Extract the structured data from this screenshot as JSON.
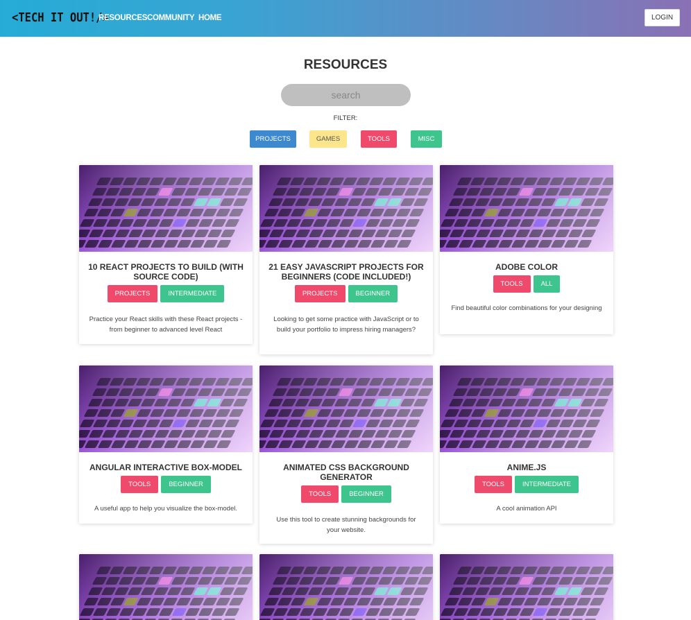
{
  "nav": {
    "logo": "<TECH IT OUT!/>",
    "links": [
      "RESOURCES",
      "COMMUNITY",
      "HOME"
    ],
    "login": "LOGIN"
  },
  "page": {
    "title": "RESOURCES",
    "search_placeholder": "search",
    "filter_label": "FILTER:",
    "filters": [
      "PROJECTS",
      "GAMES",
      "TOOLS",
      "MISC"
    ]
  },
  "colors": {
    "projects": "#3c89cf",
    "games": "#fde58c",
    "tools": "#ef4a6c",
    "misc": "#3ec48d"
  },
  "cards": [
    {
      "title": "10 REACT PROJECTS TO BUILD (WITH SOURCE CODE)",
      "tags": [
        "PROJECTS",
        "INTERMEDIATE"
      ],
      "description": "Practice your React skills with these React projects - from beginner to advanced level React"
    },
    {
      "title": "21 EASY JAVASCRIPT PROJECTS FOR BEGINNERS (CODE INCLUDED!)",
      "tags": [
        "PROJECTS",
        "BEGINNER"
      ],
      "description": "Looking to get some practice with JavaScript or to build your portfolio to impress hiring managers?"
    },
    {
      "title": "ADOBE COLOR",
      "tags": [
        "TOOLS",
        "ALL"
      ],
      "description": "Find beautiful color combinations for your designing"
    },
    {
      "title": "ANGULAR INTERACTIVE BOX-MODEL",
      "tags": [
        "TOOLS",
        "BEGINNER"
      ],
      "description": "A useful app to help you visualize the box-model."
    },
    {
      "title": "ANIMATED CSS BACKGROUND GENERATOR",
      "tags": [
        "TOOLS",
        "BEGINNER"
      ],
      "description": "Use this tool to create stunning backgrounds for your website."
    },
    {
      "title": "ANIME.JS",
      "tags": [
        "TOOLS",
        "INTERMEDIATE"
      ],
      "description": "A cool animation API"
    }
  ]
}
